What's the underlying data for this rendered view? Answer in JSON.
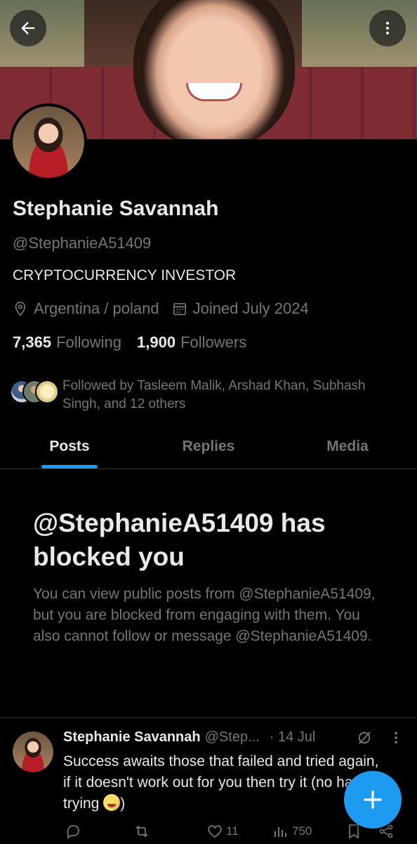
{
  "profile": {
    "name": "Stephanie Savannah",
    "handle": "@StephanieA51409",
    "bio": "CRYPTOCURRENCY INVESTOR",
    "location": "Argentina / poland",
    "joined": "Joined July 2024",
    "following_count": "7,365",
    "following_label": "Following",
    "followers_count": "1,900",
    "followers_label": "Followers",
    "followed_by": "Followed by Tasleem Malik, Arshad Khan, Subhash Singh, and 12 others"
  },
  "tabs": [
    {
      "label": "Posts",
      "active": true
    },
    {
      "label": "Replies",
      "active": false
    },
    {
      "label": "Media",
      "active": false
    }
  ],
  "blocked": {
    "title": "@StephanieA51409 has blocked you",
    "text": "You can view public posts from @StephanieA51409, but you are blocked from engaging with them. You also cannot follow or message @StephanieA51409."
  },
  "post": {
    "name": "Stephanie Savannah",
    "handle": "@Step...",
    "time": "· 14 Jul",
    "text": "Success awaits those that failed and tried again, if it doesn't work out for you then try it (no harm in trying ",
    "text_end": ")",
    "likes": "11",
    "views": "750"
  },
  "icons": {
    "back": "arrow-left-icon",
    "more": "more-vertical-icon",
    "location": "location-pin-icon",
    "calendar": "calendar-icon",
    "compose": "plus-icon"
  },
  "colors": {
    "accent": "#1d9bf0",
    "background": "#000000",
    "text_primary": "#e7e9ea",
    "text_secondary": "#71767b"
  }
}
